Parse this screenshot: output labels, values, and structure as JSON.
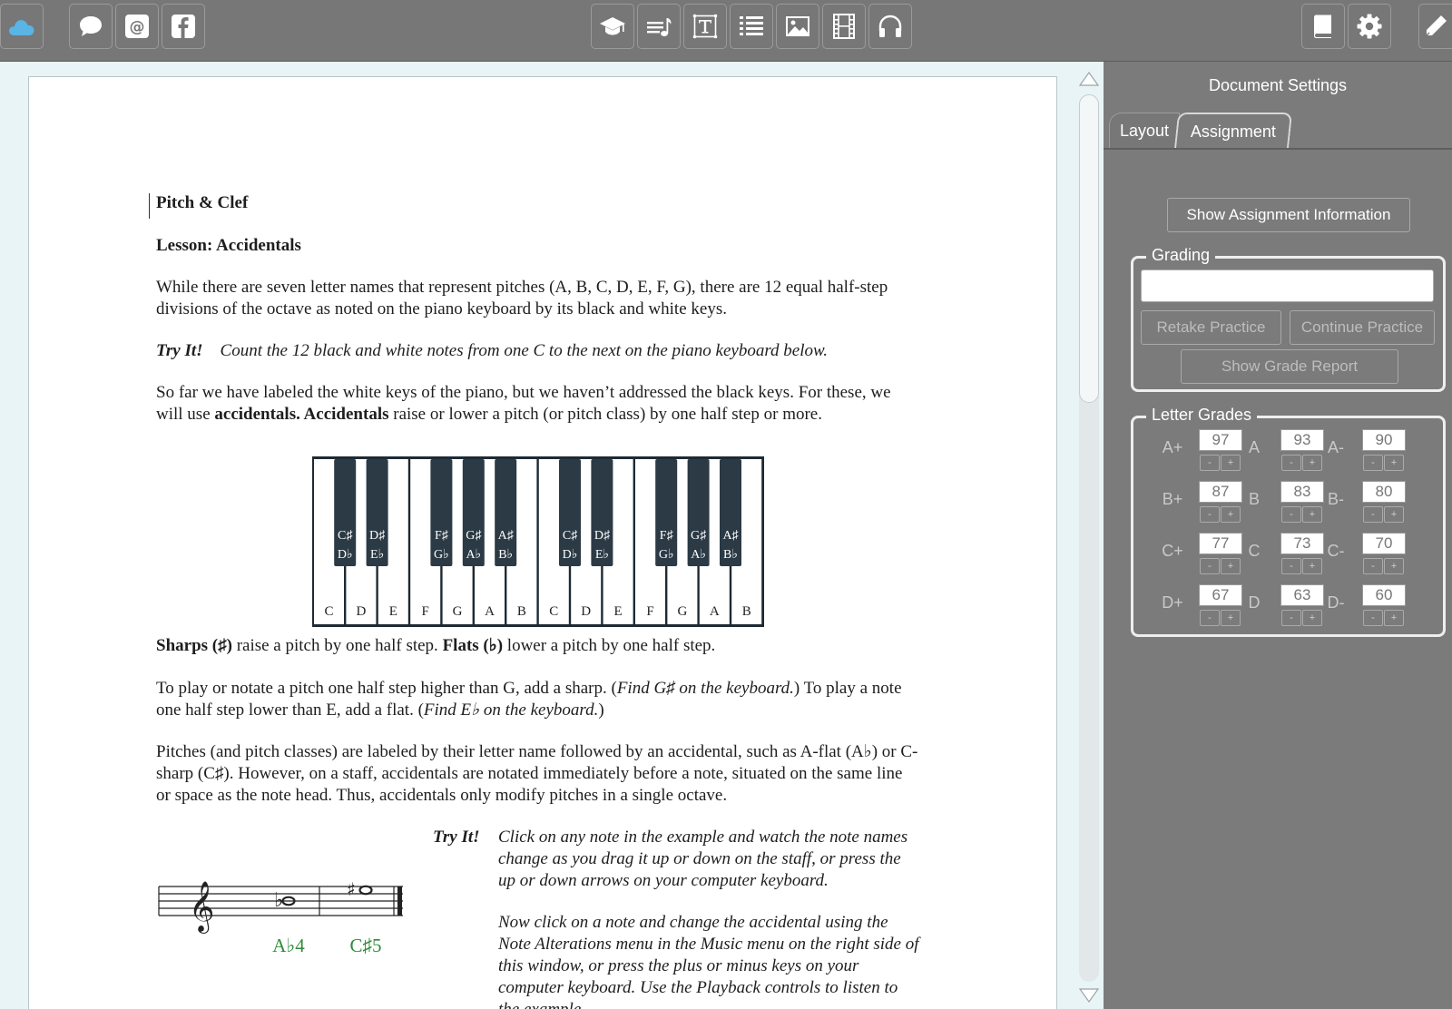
{
  "toolbar": {
    "left_buttons": [
      "cloud-icon",
      "chat-icon",
      "at-sign-icon",
      "facebook-icon"
    ],
    "center_buttons": [
      "graduation-cap-icon",
      "music-notes-icon",
      "text-box-icon",
      "list-icon",
      "image-icon",
      "film-icon",
      "headphones-icon"
    ],
    "right_buttons": [
      "book-icon",
      "gear-icon",
      "pencil-icon"
    ],
    "accent_color": "#5ab4e5"
  },
  "document": {
    "title": "Pitch & Clef",
    "lesson": "Lesson: Accidentals",
    "para1": "While there are seven letter names that represent pitches (A, B, C, D, E, F, G), there are 12 equal half-step divisions of the octave as noted on the piano keyboard by its black and white keys.",
    "tryit_label": "Try It!",
    "tryit1": "Count the 12 black and white notes from one C to the next on the piano keyboard below.",
    "para2_a": "So far we have labeled the white keys of the piano, but we haven’t addressed the black keys. For these, we will use ",
    "para2_b": "accidentals. Accidentals",
    "para2_c": " raise or lower a pitch (or pitch class) by one half step or more.",
    "para3_a": "Sharps (♯)",
    "para3_b": " raise a pitch by one half step. ",
    "para3_c": "Flats (♭)",
    "para3_d": " lower a pitch by one half step.",
    "para4_a": "To play or notate a pitch one half step higher than G, add a sharp. (",
    "para4_b": "Find G♯ on the keyboard.",
    "para4_c": ") To play a note one half step lower than E, add a flat. (",
    "para4_d": "Find E♭ on the keyboard.",
    "para4_e": ")",
    "para5": "Pitches (and pitch classes) are labeled by their letter name followed by an accidental, such as A-flat (A♭) or C-sharp (C♯). However, on a staff, accidentals are notated immediately before a note, situated on the same line or space as the note head. Thus, accidentals only modify pitches in a single octave.",
    "tryit2_a": "Click on any note in the example and watch the note names change as you drag it up or down on the staff, or press the up or down arrows on your computer keyboard.",
    "tryit2_b": "Now click on a note and change the accidental using the Note Alterations menu in the Music menu on the right side of this window, or press the plus or minus keys on your computer keyboard. Use the Playback controls to listen to the example."
  },
  "keyboard": {
    "white_keys": [
      "C",
      "D",
      "E",
      "F",
      "G",
      "A",
      "B",
      "C",
      "D",
      "E",
      "F",
      "G",
      "A",
      "B"
    ],
    "black_keys": [
      {
        "sharp": "C♯",
        "flat": "D♭"
      },
      {
        "sharp": "D♯",
        "flat": "E♭"
      },
      {
        "sharp": "F♯",
        "flat": "G♭"
      },
      {
        "sharp": "G♯",
        "flat": "A♭"
      },
      {
        "sharp": "A♯",
        "flat": "B♭"
      },
      {
        "sharp": "C♯",
        "flat": "D♭"
      },
      {
        "sharp": "D♯",
        "flat": "E♭"
      },
      {
        "sharp": "F♯",
        "flat": "G♭"
      },
      {
        "sharp": "G♯",
        "flat": "A♭"
      },
      {
        "sharp": "A♯",
        "flat": "B♭"
      }
    ]
  },
  "staff": {
    "note1_label": "A♭4",
    "note2_label": "C♯5",
    "label_color": "#2e8b3a"
  },
  "panel": {
    "title": "Document Settings",
    "tabs": {
      "layout": "Layout",
      "assignment": "Assignment"
    },
    "show_info_button": "Show Assignment Information",
    "grading": {
      "legend": "Grading",
      "input_value": "",
      "retake_button": "Retake Practice",
      "continue_button": "Continue Practice",
      "report_button": "Show Grade Report"
    },
    "letter_grades": {
      "legend": "Letter Grades",
      "grades": [
        {
          "label": "A+",
          "value": "97"
        },
        {
          "label": "A",
          "value": "93"
        },
        {
          "label": "A-",
          "value": "90"
        },
        {
          "label": "B+",
          "value": "87"
        },
        {
          "label": "B",
          "value": "83"
        },
        {
          "label": "B-",
          "value": "80"
        },
        {
          "label": "C+",
          "value": "77"
        },
        {
          "label": "C",
          "value": "73"
        },
        {
          "label": "C-",
          "value": "70"
        },
        {
          "label": "D+",
          "value": "67"
        },
        {
          "label": "D",
          "value": "63"
        },
        {
          "label": "D-",
          "value": "60"
        }
      ],
      "minus_label": "-",
      "plus_label": "+"
    }
  }
}
